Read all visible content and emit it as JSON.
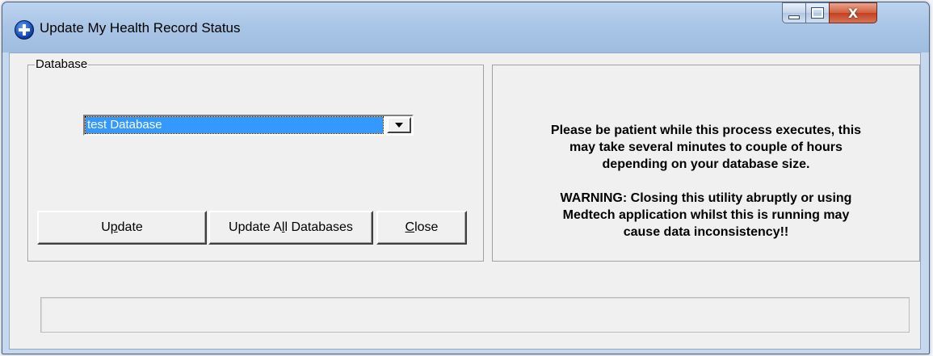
{
  "window": {
    "title": "Update My Health Record Status",
    "icon": "medtech-cross-icon",
    "controls": {
      "minimize_icon": "minimize-icon",
      "maximize_icon": "maximize-icon",
      "close_glyph": "X"
    }
  },
  "database_group": {
    "label": "Database",
    "selected_database": "test Database",
    "dropdown_icon": "chevron-down-icon"
  },
  "buttons": {
    "update": {
      "before": "U",
      "accel": "p",
      "after": "date"
    },
    "update_all": {
      "before": "Update A",
      "accel": "l",
      "after": "l Databases"
    },
    "close": {
      "before": "",
      "accel": "C",
      "after": "lose"
    }
  },
  "info": {
    "notice": "Please be patient while this process executes, this\nmay take several minutes to couple of hours\ndepending on your database size.",
    "warning": "WARNING: Closing this utility abruptly or using\nMedtech application whilst this is running may\ncause data inconsistency!!"
  },
  "progress": {
    "value_percent": 0
  },
  "colors": {
    "selection": "#3399ff",
    "dialog_bg": "#f0f0f0",
    "close_button": "#c2401d"
  }
}
